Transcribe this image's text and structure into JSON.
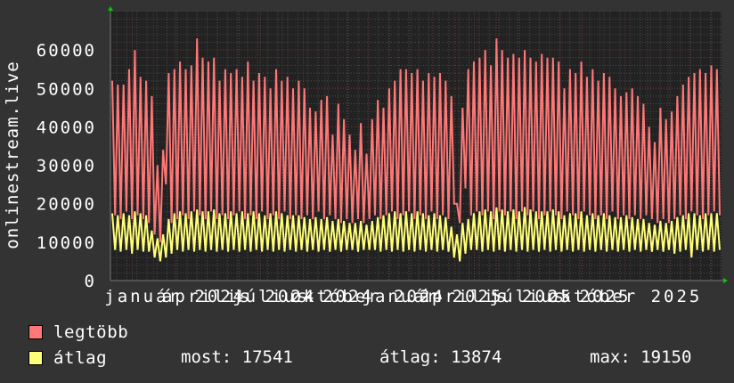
{
  "chart_data": {
    "type": "line",
    "ylabel": "onlinestream.live",
    "ylim": [
      0,
      70000
    ],
    "yticks": [
      0,
      10000,
      20000,
      30000,
      40000,
      50000,
      60000
    ],
    "xlim": [
      "2023-10-01",
      "2026-02-15"
    ],
    "xticks": [
      {
        "date": "2024-01-01",
        "label": "január 2024"
      },
      {
        "date": "2024-04-01",
        "label": "április 2024"
      },
      {
        "date": "2024-07-01",
        "label": "július 2024"
      },
      {
        "date": "2024-10-01",
        "label": "október 2024"
      },
      {
        "date": "2025-01-01",
        "label": "január 2025"
      },
      {
        "date": "2025-04-01",
        "label": "április 2025"
      },
      {
        "date": "2025-07-01",
        "label": "július 2025"
      },
      {
        "date": "2025-10-01",
        "label": "október 2025"
      }
    ],
    "grid": true,
    "series": [
      {
        "name": "legtöbb",
        "color": "#ff7777",
        "values": [
          52000,
          17000,
          51000,
          16000,
          51000,
          18000,
          55000,
          16000,
          60000,
          17000,
          53000,
          16000,
          52000,
          15000,
          48000,
          12000,
          30000,
          10000,
          34000,
          25000,
          54000,
          15000,
          55000,
          16000,
          57000,
          17000,
          55000,
          16000,
          56000,
          18000,
          63000,
          17000,
          58000,
          16000,
          57000,
          18000,
          58000,
          16000,
          52000,
          17000,
          55000,
          16000,
          54000,
          17000,
          55000,
          18000,
          53000,
          16000,
          57000,
          17000,
          52000,
          16000,
          54000,
          18000,
          53000,
          16000,
          50000,
          17000,
          55000,
          16000,
          52000,
          18000,
          53000,
          16000,
          50000,
          17000,
          52000,
          16000,
          50000,
          17000,
          45000,
          16000,
          44000,
          18000,
          47000,
          16000,
          48000,
          17000,
          38000,
          16000,
          46000,
          15000,
          42000,
          16000,
          38000,
          15000,
          34000,
          16000,
          41000,
          15000,
          33000,
          16000,
          42000,
          17000,
          47000,
          16000,
          45000,
          17000,
          50000,
          18000,
          52000,
          16000,
          55000,
          17000,
          55000,
          18000,
          54000,
          16000,
          55000,
          17000,
          52000,
          16000,
          54000,
          18000,
          53000,
          16000,
          54000,
          17000,
          52000,
          16000,
          48000,
          20000,
          20000,
          15000,
          45000,
          24000,
          55000,
          17000,
          57000,
          18000,
          58000,
          17000,
          60000,
          18000,
          56000,
          16000,
          63000,
          18000,
          60000,
          17000,
          58000,
          18000,
          59000,
          16000,
          58000,
          18000,
          60000,
          17000,
          58000,
          18000,
          57000,
          16000,
          59000,
          17000,
          58000,
          18000,
          58000,
          17000,
          57000,
          16000,
          50000,
          18000,
          55000,
          17000,
          54000,
          16000,
          57000,
          18000,
          53000,
          17000,
          55000,
          16000,
          52000,
          17000,
          54000,
          16000,
          53000,
          18000,
          50000,
          16000,
          48000,
          17000,
          49000,
          16000,
          50000,
          17000,
          48000,
          16000,
          46000,
          17000,
          40000,
          16000,
          36000,
          15000,
          45000,
          16000,
          42000,
          15000,
          44000,
          16000,
          48000,
          17000,
          51000,
          16000,
          53000,
          18000,
          54000,
          17000,
          55000,
          16000,
          54000,
          17000,
          56000,
          18000,
          55000,
          17000
        ]
      },
      {
        "name": "átlag",
        "color": "#ffff77",
        "values": [
          17500,
          8000,
          17000,
          7500,
          17500,
          8000,
          17000,
          7000,
          18000,
          8000,
          17500,
          7500,
          17000,
          7500,
          13000,
          6000,
          11000,
          5000,
          12000,
          6000,
          16000,
          7000,
          17500,
          8000,
          18000,
          7500,
          17500,
          8000,
          18000,
          7500,
          18500,
          8000,
          18000,
          7500,
          18000,
          8000,
          18500,
          7500,
          17500,
          8000,
          17500,
          7500,
          18000,
          8000,
          17500,
          7500,
          18000,
          8000,
          17500,
          7500,
          18000,
          8000,
          17500,
          7500,
          17000,
          8000,
          17500,
          7500,
          18000,
          8000,
          17500,
          7500,
          17000,
          8000,
          17000,
          7500,
          17000,
          8000,
          16500,
          7500,
          16000,
          8000,
          16500,
          7500,
          16000,
          8000,
          16500,
          7500,
          15500,
          8000,
          16000,
          7500,
          15500,
          8000,
          15000,
          8000,
          15000,
          7500,
          15500,
          8000,
          14500,
          8000,
          15500,
          8000,
          16500,
          7500,
          17000,
          8000,
          17500,
          7500,
          18000,
          8000,
          17500,
          7500,
          18000,
          8000,
          17500,
          7500,
          18000,
          8000,
          17500,
          7500,
          17000,
          8000,
          17500,
          7500,
          17000,
          8000,
          16500,
          7500,
          14000,
          6000,
          12000,
          5000,
          15000,
          7000,
          16000,
          8000,
          17500,
          8000,
          18000,
          7500,
          18500,
          8000,
          18000,
          7500,
          19000,
          8000,
          18500,
          7500,
          18000,
          8000,
          18500,
          7500,
          18000,
          8000,
          19150,
          7500,
          18500,
          8000,
          18000,
          7500,
          18000,
          8000,
          18000,
          7500,
          18500,
          8000,
          18000,
          7500,
          17000,
          8000,
          17500,
          7500,
          17500,
          8000,
          18000,
          7500,
          17000,
          8000,
          17500,
          7500,
          17000,
          8000,
          17500,
          7500,
          17000,
          8000,
          16500,
          7500,
          16500,
          8000,
          17000,
          7500,
          16500,
          8000,
          16000,
          7500,
          16000,
          8000,
          15000,
          7500,
          14500,
          8000,
          15500,
          7500,
          15000,
          8000,
          15500,
          7000,
          16500,
          7500,
          17000,
          8000,
          17500,
          6000,
          17500,
          8000,
          17000,
          7500,
          17500,
          8000,
          17500,
          7500,
          17541,
          8000
        ]
      }
    ],
    "legend": {
      "placement": "bottom-left",
      "items": [
        {
          "label": "legtöbb",
          "color": "#ff7777"
        },
        {
          "label": "átlag",
          "color": "#ffff77"
        }
      ],
      "stats": {
        "most": "most: 17541",
        "atlag": "átlag: 13874",
        "max": "max: 19150"
      }
    },
    "background": "#333333",
    "plot_background": "#222222"
  }
}
